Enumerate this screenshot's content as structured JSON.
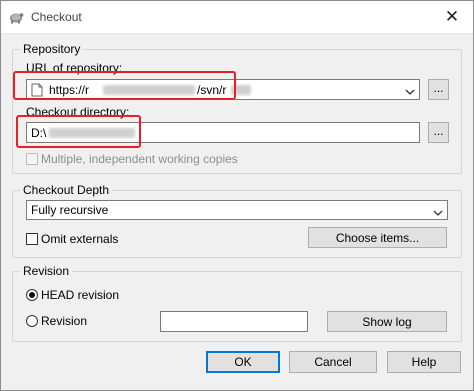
{
  "window": {
    "title": "Checkout",
    "close_glyph": "✕",
    "app_icon": "tortoise-svn-icon"
  },
  "repository": {
    "legend": "Repository",
    "url_label": "URL of repository:",
    "url_value": "https://r",
    "url_value_suffix": "/svn/r",
    "url_browse_label": "...",
    "dir_label": "Checkout directory:",
    "dir_value": "D:\\",
    "dir_browse_label": "...",
    "multi_wc_label": "Multiple, independent working copies"
  },
  "depth": {
    "legend": "Checkout Depth",
    "selected": "Fully recursive",
    "omit_externals_label": "Omit externals",
    "choose_items_label": "Choose items..."
  },
  "revision": {
    "legend": "Revision",
    "head_label": "HEAD revision",
    "revision_label": "Revision",
    "revision_value": "",
    "show_log_label": "Show log"
  },
  "buttons": {
    "ok": "OK",
    "cancel": "Cancel",
    "help": "Help"
  },
  "colors": {
    "highlight": "#e5202a",
    "accent": "#0078d7"
  }
}
